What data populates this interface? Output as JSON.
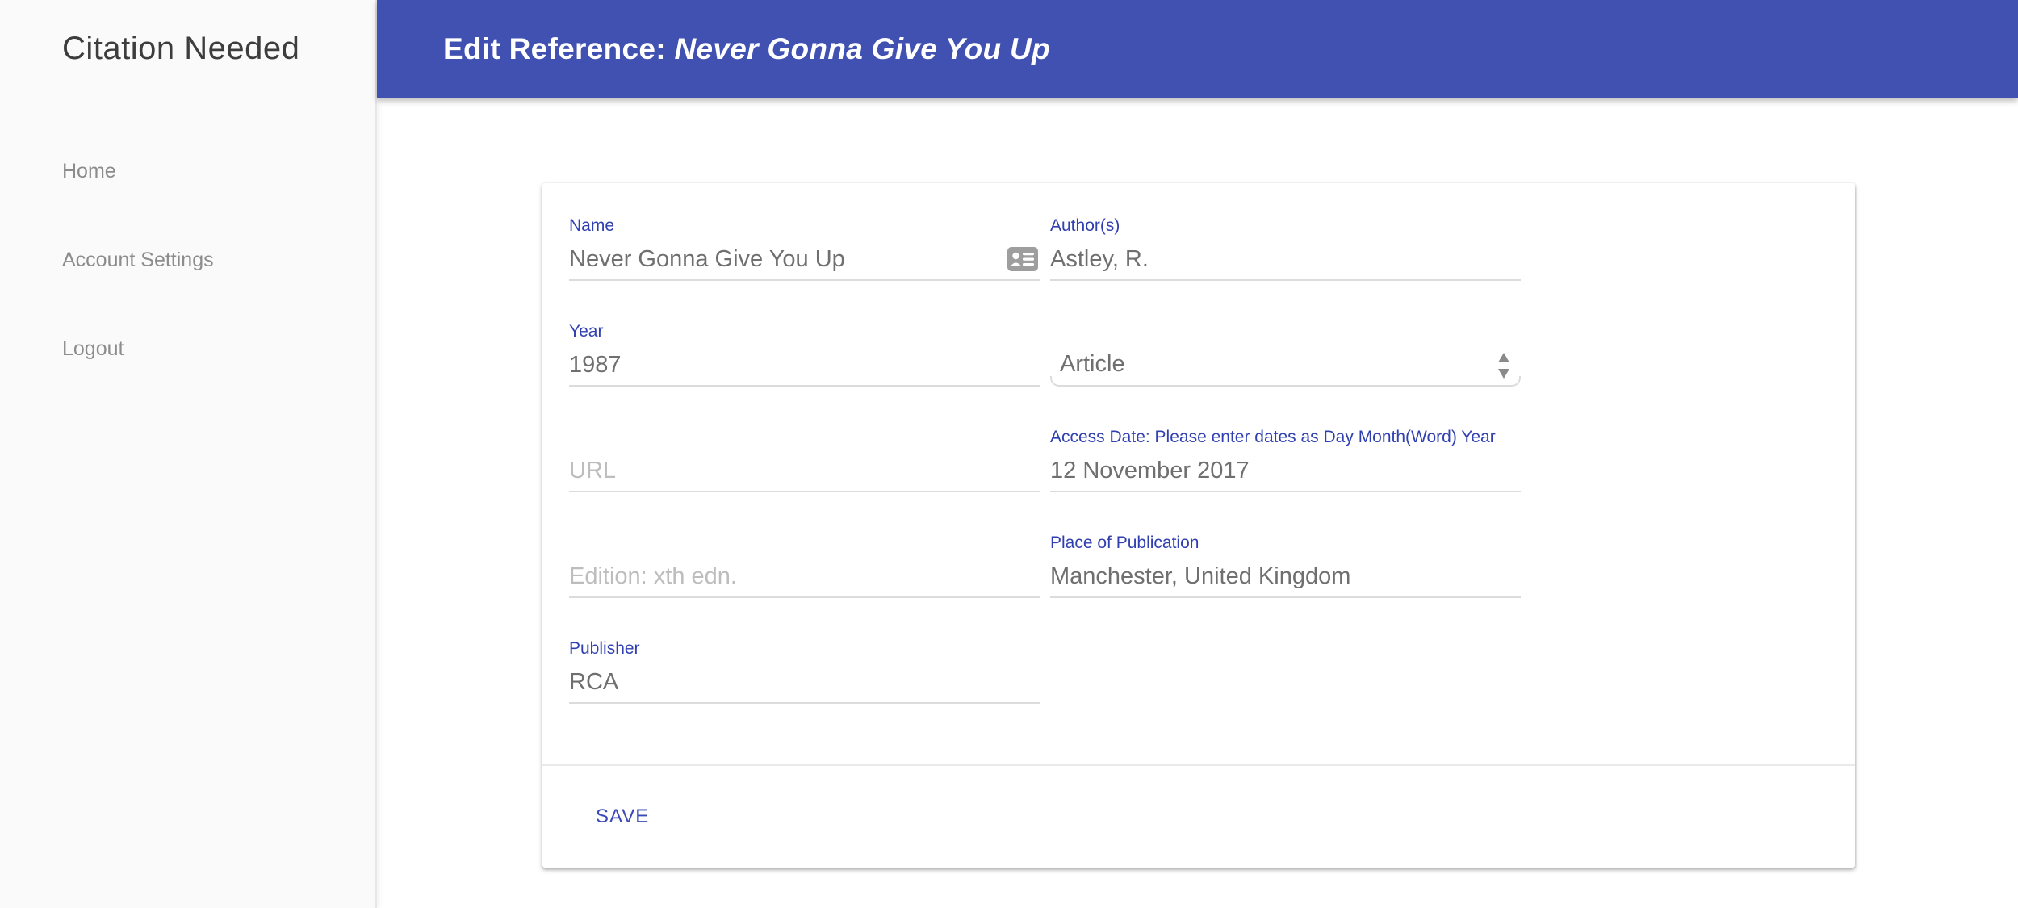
{
  "sidebar": {
    "title": "Citation Needed",
    "items": [
      {
        "label": "Home"
      },
      {
        "label": "Account Settings"
      },
      {
        "label": "Logout"
      }
    ]
  },
  "header": {
    "title_prefix": "Edit Reference: ",
    "reference_title": "Never Gonna Give You Up"
  },
  "form": {
    "fields": {
      "name": {
        "label": "Name",
        "value": "Never Gonna Give You Up"
      },
      "authors": {
        "label": "Author(s)",
        "value": "Astley, R."
      },
      "year": {
        "label": "Year",
        "value": "1987"
      },
      "type": {
        "value": "Article"
      },
      "url": {
        "placeholder": "URL"
      },
      "access_date": {
        "label": "Access Date: Please enter dates as Day Month(Word) Year",
        "value": "12 November 2017"
      },
      "edition": {
        "placeholder": "Edition: xth edn."
      },
      "place": {
        "label": "Place of Publication",
        "value": "Manchester, United Kingdom"
      },
      "publisher": {
        "label": "Publisher",
        "value": "RCA"
      }
    },
    "save_label": "SAVE"
  },
  "icons": {
    "name_field": "contact-card-icon",
    "type_select": "select-updown-arrows-icon"
  },
  "colors": {
    "appbar_background": "#4051b2",
    "label_blue": "#3140b0",
    "save_blue": "#3b4ab8",
    "value_text": "#6f6f6f",
    "placeholder_text": "#bdbdbd",
    "sidebar_background": "#fafafa",
    "sidebar_title": "#3d3d3d",
    "sidebar_link": "#8c8c8c",
    "underline": "#dcdcdc"
  }
}
